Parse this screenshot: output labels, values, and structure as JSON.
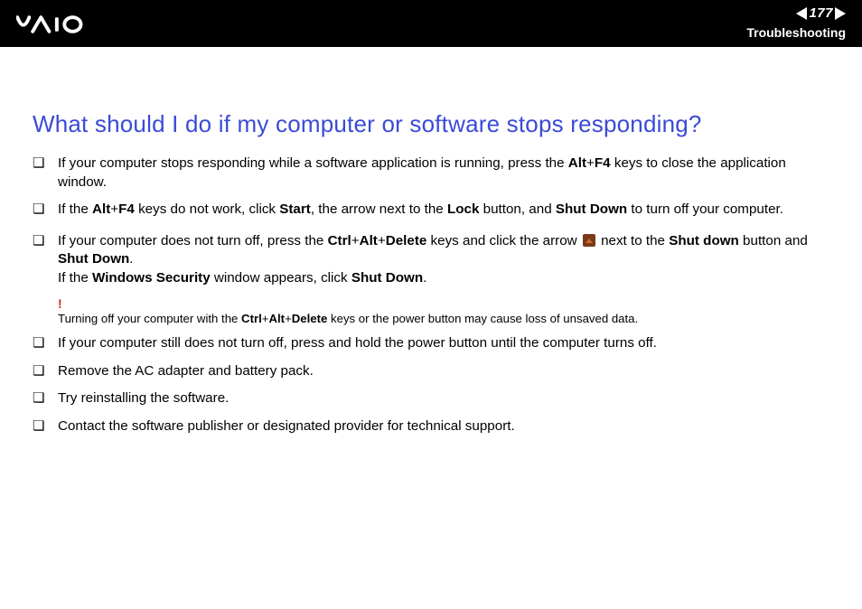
{
  "header": {
    "page_number": "177",
    "section": "Troubleshooting"
  },
  "title": "What should I do if my computer or software stops responding?",
  "items": {
    "i0": {
      "t0": "If your computer stops responding while a software application is running, press the ",
      "k0": "Alt",
      "plus0": "+",
      "k1": "F4",
      "t1": " keys to close the application window."
    },
    "i1": {
      "t0": "If the ",
      "k0": "Alt",
      "plus0": "+",
      "k1": "F4",
      "t1": " keys do not work, click ",
      "k2": "Start",
      "t2": ", the arrow next to the ",
      "k3": "Lock",
      "t3": " button, and ",
      "k4": "Shut Down",
      "t4": " to turn off your computer."
    },
    "i2": {
      "t0": "If your computer does not turn off, press the ",
      "k0": "Ctrl",
      "plus0": "+",
      "k1": "Alt",
      "plus1": "+",
      "k2": "Delete",
      "t1": " keys and click the arrow ",
      "t2": " next to the ",
      "k3": "Shut down",
      "t3": " button and ",
      "k4": "Shut Down",
      "t4": ".",
      "t5": "If the ",
      "k5": "Windows Security",
      "t6": " window appears, click ",
      "k6": "Shut Down",
      "t7": "."
    },
    "warn": {
      "mark": "!",
      "t0": "Turning off your computer with the ",
      "k0": "Ctrl",
      "plus0": "+",
      "k1": "Alt",
      "plus1": "+",
      "k2": "Delete",
      "t1": " keys or the power button may cause loss of unsaved data."
    },
    "i3": "If your computer still does not turn off, press and hold the power button until the computer turns off.",
    "i4": "Remove the AC adapter and battery pack.",
    "i5": "Try reinstalling the software.",
    "i6": "Contact the software publisher or designated provider for technical support."
  }
}
